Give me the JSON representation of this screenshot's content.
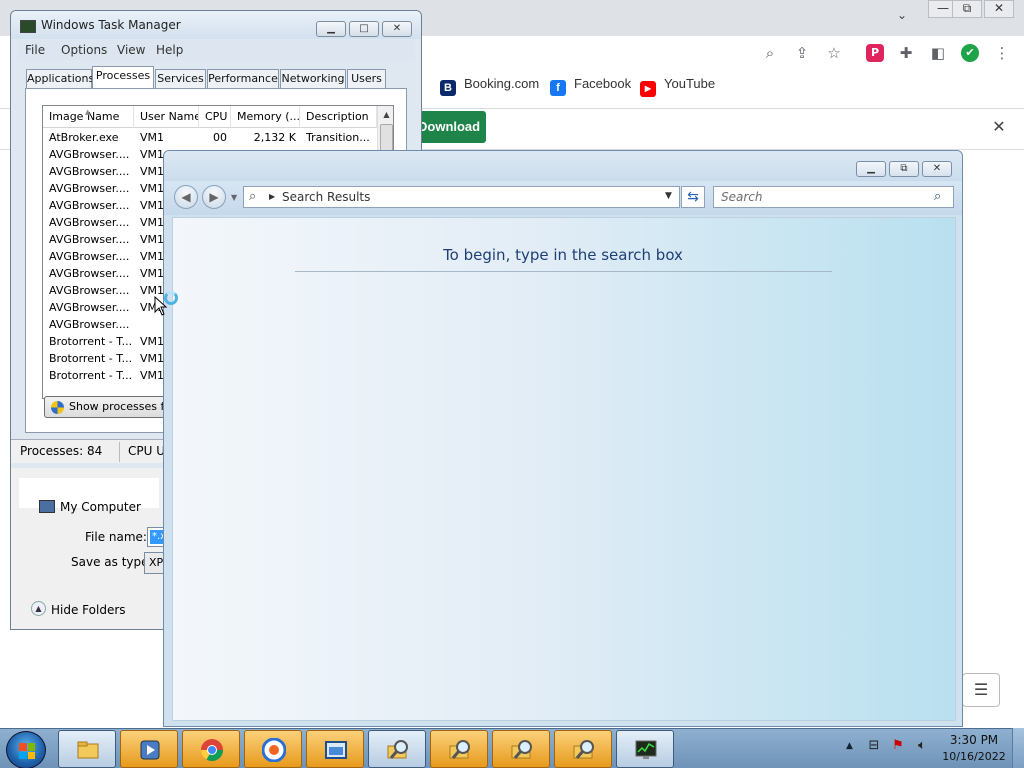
{
  "chrome": {
    "window_controls": {
      "minimize": "—",
      "restore": "⧉",
      "close": "✕"
    },
    "bookmarks": [
      {
        "label": "Booking.com",
        "icon": "booking-icon",
        "glyph": "B"
      },
      {
        "label": "Facebook",
        "icon": "facebook-icon",
        "glyph": "f"
      },
      {
        "label": "YouTube",
        "icon": "youtube-icon",
        "glyph": "▶"
      }
    ],
    "infobar": {
      "download_label": "Download"
    },
    "extensions": {
      "p_label": "P",
      "shield_label": "✔"
    }
  },
  "task_manager": {
    "title": "Windows Task Manager",
    "menu": [
      "File",
      "Options",
      "View",
      "Help"
    ],
    "tabs": [
      "Applications",
      "Processes",
      "Services",
      "Performance",
      "Networking",
      "Users"
    ],
    "active_tab": "Processes",
    "columns": [
      "Image Name",
      "User Name",
      "CPU",
      "Memory (...",
      "Description"
    ],
    "rows": [
      {
        "image": "AtBroker.exe",
        "user": "VM1",
        "cpu": "00",
        "memory": "2,132 K",
        "description": "Transition..."
      },
      {
        "image": "AVGBrowser....",
        "user": "VM1",
        "cpu": "",
        "memory": "",
        "description": ""
      },
      {
        "image": "AVGBrowser....",
        "user": "VM1",
        "cpu": "",
        "memory": "",
        "description": ""
      },
      {
        "image": "AVGBrowser....",
        "user": "VM1",
        "cpu": "",
        "memory": "",
        "description": ""
      },
      {
        "image": "AVGBrowser....",
        "user": "VM1",
        "cpu": "",
        "memory": "",
        "description": ""
      },
      {
        "image": "AVGBrowser....",
        "user": "VM1",
        "cpu": "",
        "memory": "",
        "description": ""
      },
      {
        "image": "AVGBrowser....",
        "user": "VM1",
        "cpu": "",
        "memory": "",
        "description": ""
      },
      {
        "image": "AVGBrowser....",
        "user": "VM1",
        "cpu": "",
        "memory": "",
        "description": ""
      },
      {
        "image": "AVGBrowser....",
        "user": "VM1",
        "cpu": "",
        "memory": "",
        "description": ""
      },
      {
        "image": "AVGBrowser....",
        "user": "VM1",
        "cpu": "",
        "memory": "",
        "description": ""
      },
      {
        "image": "AVGBrowser....",
        "user": "VM1",
        "cpu": "",
        "memory": "",
        "description": ""
      },
      {
        "image": "AVGBrowser....",
        "user": "",
        "cpu": "",
        "memory": "",
        "description": ""
      },
      {
        "image": "Brotorrent - T...",
        "user": "VM1",
        "cpu": "",
        "memory": "",
        "description": ""
      },
      {
        "image": "Brotorrent - T...",
        "user": "VM1",
        "cpu": "",
        "memory": "",
        "description": ""
      },
      {
        "image": "Brotorrent - T...",
        "user": "VM1",
        "cpu": "",
        "memory": "",
        "description": ""
      }
    ],
    "show_processes_button": "Show processes from all users",
    "status": {
      "processes": "Processes: 84",
      "cpu": "CPU Usage"
    }
  },
  "save_dialog": {
    "my_computer": "My Computer",
    "file_name_label": "File name:",
    "file_name_value": "*.x",
    "save_as_type_label": "Save as type:",
    "save_as_type_value": "XPS",
    "hide_folders": "Hide Folders"
  },
  "search_window": {
    "address": "Search Results",
    "search_placeholder": "Search",
    "empty_message": "To begin, type in the search box"
  },
  "taskbar": {
    "buttons": [
      {
        "name": "explorer-taskbar-button",
        "icon": "folder-icon"
      },
      {
        "name": "media-taskbar-button",
        "icon": "media-player-icon"
      },
      {
        "name": "chrome-taskbar-button",
        "icon": "chrome-icon"
      },
      {
        "name": "avg-browser-taskbar-button",
        "icon": "avg-browser-icon"
      },
      {
        "name": "window-taskbar-button",
        "icon": "window-icon"
      },
      {
        "name": "search-taskbar-button-1",
        "icon": "search-folder-icon"
      },
      {
        "name": "search-taskbar-button-2",
        "icon": "search-folder-icon"
      },
      {
        "name": "search-taskbar-button-3",
        "icon": "search-folder-icon"
      },
      {
        "name": "search-taskbar-button-4",
        "icon": "search-folder-icon"
      },
      {
        "name": "taskmgr-taskbar-button",
        "icon": "task-manager-icon"
      }
    ],
    "clock_time": "3:30 PM",
    "clock_date": "10/16/2022"
  }
}
